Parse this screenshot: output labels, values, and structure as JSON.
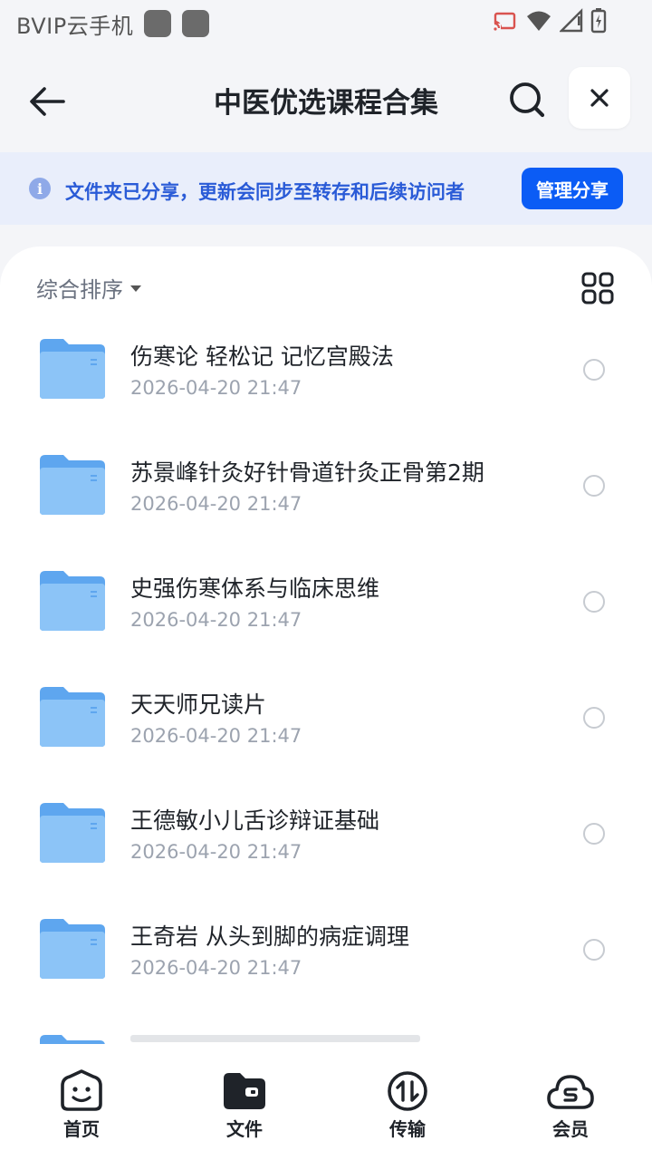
{
  "status_bar": {
    "title": "BVIP云手机"
  },
  "header": {
    "title": "中医优选课程合集"
  },
  "share_banner": {
    "info_symbol": "i",
    "text": "文件夹已分享，更新会同步至转存和后续访问者",
    "manage_label": "管理分享"
  },
  "toolbar": {
    "sort_label": "综合排序"
  },
  "files": [
    {
      "name": "伤寒论 轻松记 记忆宫殿法",
      "date": "2026-04-20 21:47"
    },
    {
      "name": "苏景峰针灸好针骨道针灸正骨第2期",
      "date": "2026-04-20 21:47"
    },
    {
      "name": "史强伤寒体系与临床思维",
      "date": "2026-04-20 21:47"
    },
    {
      "name": "天天师兄读片",
      "date": "2026-04-20 21:47"
    },
    {
      "name": "王德敏小儿舌诊辩证基础",
      "date": "2026-04-20 21:47"
    },
    {
      "name": "王奇岩 从头到脚的病症调理",
      "date": "2026-04-20 21:47"
    }
  ],
  "bottom_nav": [
    {
      "label": "首页",
      "icon": "smile-face-icon"
    },
    {
      "label": "文件",
      "icon": "folder-icon"
    },
    {
      "label": "传输",
      "icon": "transfer-icon"
    },
    {
      "label": "会员",
      "icon": "cloud-vip-icon"
    }
  ],
  "colors": {
    "accent": "#0b5cf5",
    "banner_bg": "#e9eefb",
    "banner_text": "#2a5bd7",
    "folder": "#7ab8f5"
  }
}
